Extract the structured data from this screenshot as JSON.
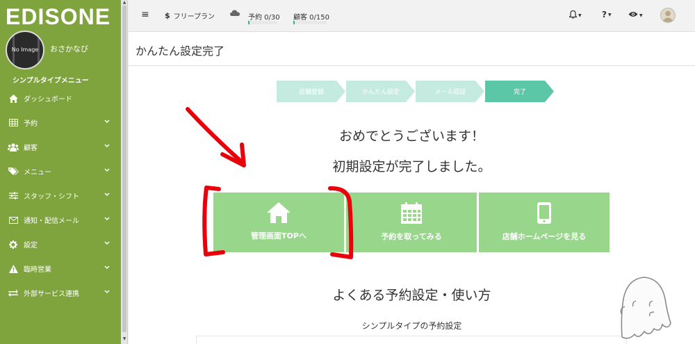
{
  "sidebar": {
    "brand": "EDISONE",
    "avatar_placeholder": "No Image",
    "shop_name": "おさかなび",
    "menu_type": "シンプルタイプメニュー",
    "items": [
      {
        "label": "ダッシュボード",
        "icon": "home-icon",
        "chevron": false
      },
      {
        "label": "予約",
        "icon": "table-icon",
        "chevron": true
      },
      {
        "label": "顧客",
        "icon": "users-icon",
        "chevron": true
      },
      {
        "label": "メニュー",
        "icon": "tags-icon",
        "chevron": true
      },
      {
        "label": "スタッフ・シフト",
        "icon": "sliders-icon",
        "chevron": true
      },
      {
        "label": "通知・配信メール",
        "icon": "envelope-icon",
        "chevron": true
      },
      {
        "label": "設定",
        "icon": "gear-icon",
        "chevron": true
      },
      {
        "label": "臨時営業",
        "icon": "warning-icon",
        "chevron": true
      },
      {
        "label": "外部サービス連携",
        "icon": "exchange-icon",
        "chevron": true
      }
    ]
  },
  "topbar": {
    "menu_icon": "≡",
    "plan_symbol": "$",
    "plan": "フリープラン",
    "reservations": "予約 0/30",
    "reservations_fraction": 0.0,
    "customers": "顧客 0/150",
    "customers_fraction": 0.0,
    "help_symbol": "?"
  },
  "content": {
    "page_title": "かんたん設定完了",
    "steps": [
      {
        "label": "店舗登録",
        "active": false
      },
      {
        "label": "かんたん設定",
        "active": false
      },
      {
        "label": "メール認証",
        "active": false
      },
      {
        "label": "完了",
        "active": true
      }
    ],
    "congrats_line1": "おめでとうございます！",
    "congrats_line2": "初期設定が完了しました。",
    "buttons": [
      {
        "label": "管理画面TOPへ",
        "icon": "home-icon"
      },
      {
        "label": "予約を取ってみる",
        "icon": "calendar-icon"
      },
      {
        "label": "店舗ホームページを見る",
        "icon": "mobile-icon"
      }
    ],
    "usage_title": "よくある予約設定・使い方",
    "usage_subtitle": "シンプルタイプの予約設定"
  },
  "colors": {
    "sidebar": "#7fa33d",
    "step_inactive": "#c5ebe1",
    "step_active": "#5cc7a6",
    "button": "#97d68b",
    "annotation": "#e8000b"
  }
}
